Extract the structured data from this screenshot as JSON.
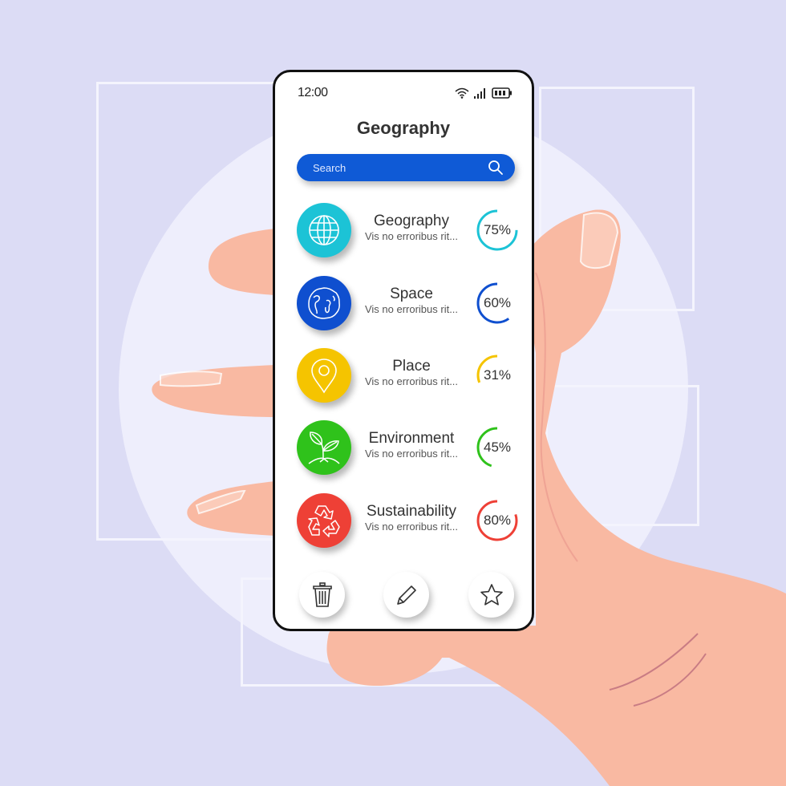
{
  "status_bar": {
    "time": "12:00",
    "icons": [
      "wifi-icon",
      "signal-icon",
      "battery-icon"
    ]
  },
  "header": {
    "title": "Geography"
  },
  "search": {
    "placeholder": "Search",
    "icon": "search-icon"
  },
  "colors": {
    "search_bg": "#0f5ad6",
    "geography": "#1cc3d6",
    "space": "#0f4fcf",
    "place": "#f5c400",
    "environment": "#2fc21b",
    "sustainability": "#ee4036"
  },
  "topics": [
    {
      "title": "Geography",
      "subtitle": "Vis no erroribus rit...",
      "icon": "globe-icon",
      "progress": 75,
      "progress_label": "75%",
      "color": "#1cc3d6"
    },
    {
      "title": "Space",
      "subtitle": "Vis no erroribus rit...",
      "icon": "planet-icon",
      "progress": 60,
      "progress_label": "60%",
      "color": "#0f4fcf"
    },
    {
      "title": "Place",
      "subtitle": "Vis no erroribus rit...",
      "icon": "map-pin-icon",
      "progress": 31,
      "progress_label": "31%",
      "color": "#f5c400"
    },
    {
      "title": "Environment",
      "subtitle": "Vis no erroribus rit...",
      "icon": "sprout-icon",
      "progress": 45,
      "progress_label": "45%",
      "color": "#2fc21b"
    },
    {
      "title": "Sustainability",
      "subtitle": "Vis no erroribus rit...",
      "icon": "recycle-icon",
      "progress": 80,
      "progress_label": "80%",
      "color": "#ee4036"
    }
  ],
  "actions": [
    {
      "name": "delete",
      "icon": "trash-icon"
    },
    {
      "name": "edit",
      "icon": "pencil-icon"
    },
    {
      "name": "favorite",
      "icon": "star-icon"
    }
  ]
}
